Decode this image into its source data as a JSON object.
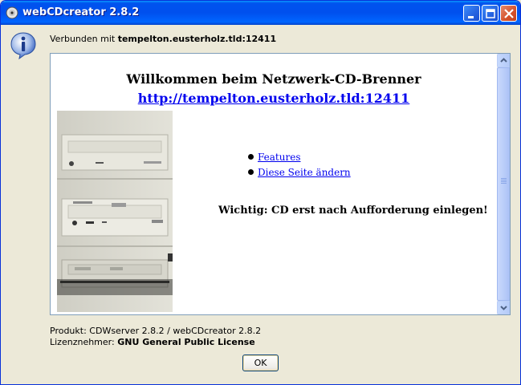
{
  "window": {
    "title": "webCDcreator 2.8.2"
  },
  "status": {
    "connected_prefix": "Verbunden mit",
    "connected_host": "tempelton.eusterholz.tld:12411"
  },
  "page": {
    "heading": "Willkommen beim Netzwerk-CD-Brenner",
    "heading_link": "http://tempelton.eusterholz.tld:12411",
    "links": [
      {
        "label": "Features"
      },
      {
        "label": "Diese Seite ändern"
      }
    ],
    "notice": "Wichtig: CD erst nach Aufforderung einlegen!"
  },
  "footer": {
    "product_line": "Produkt: CDWserver 2.8.2  / webCDcreator 2.8.2",
    "license_prefix": "Lizenznehmer:",
    "license_value": "GNU General Public License"
  },
  "buttons": {
    "ok": "OK"
  },
  "icons": {
    "app": "cd-disc-icon",
    "info": "info-icon"
  },
  "colors": {
    "titlebar": "#0053ee",
    "link": "#0000ee",
    "close_button": "#d5512b"
  }
}
